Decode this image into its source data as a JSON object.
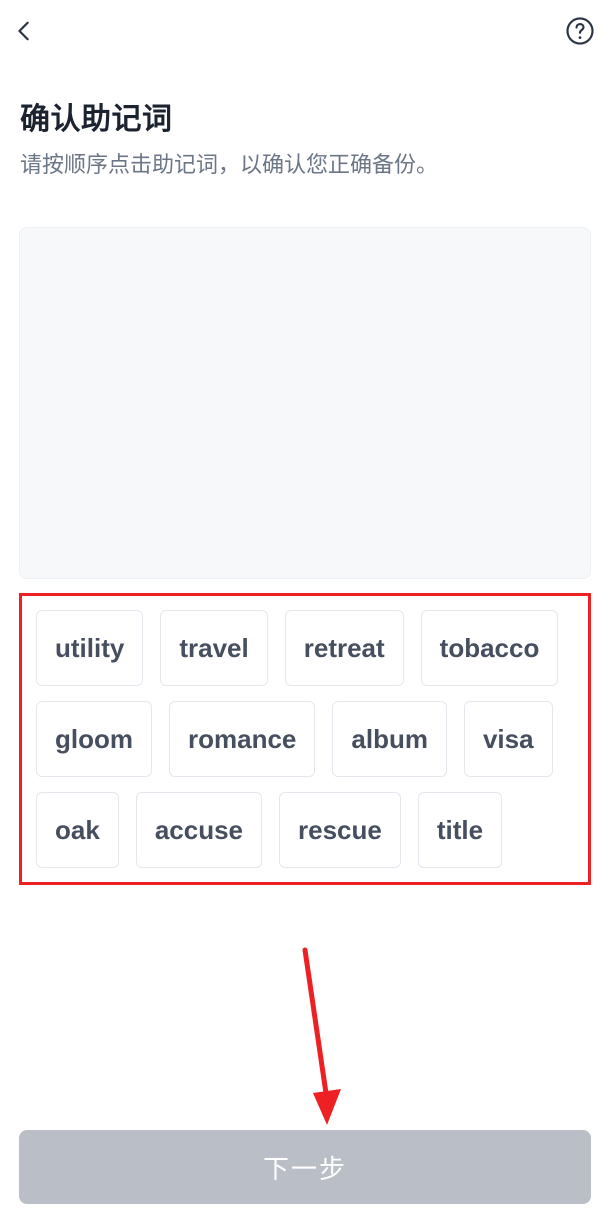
{
  "header": {
    "title": "确认助记词",
    "subtitle": "请按顺序点击助记词，以确认您正确备份。"
  },
  "words": {
    "row1": [
      "utility",
      "travel",
      "retreat",
      "tobacco"
    ],
    "row2": [
      "gloom",
      "romance",
      "album",
      "visa"
    ],
    "row3": [
      "oak",
      "accuse",
      "rescue",
      "title"
    ]
  },
  "footer": {
    "next_label": "下一步"
  },
  "colors": {
    "highlight_border": "#ed2024",
    "button_disabled": "#b9bec7",
    "text_primary": "#1b2330",
    "text_secondary": "#6b7686",
    "chip_text": "#464f5f"
  }
}
